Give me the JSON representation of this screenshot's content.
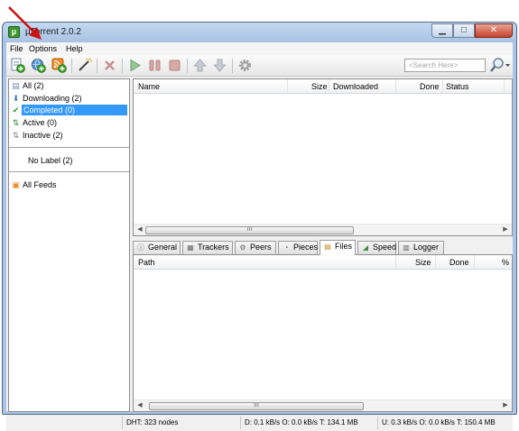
{
  "window": {
    "title": "µTorrent 2.0.2",
    "app_icon": "µ"
  },
  "menu": [
    "File",
    "Options",
    "Help"
  ],
  "toolbar": {
    "buttons": [
      {
        "name": "add-torrent",
        "icon": "add-torrent-icon"
      },
      {
        "name": "add-torrent-url",
        "icon": "add-url-icon"
      },
      {
        "name": "add-rss-feed",
        "icon": "add-rss-icon"
      },
      {
        "name": "create-torrent",
        "icon": "magic-wand-icon"
      },
      {
        "name": "remove",
        "icon": "delete-icon"
      },
      {
        "name": "start",
        "icon": "play-icon"
      },
      {
        "name": "pause",
        "icon": "pause-icon"
      },
      {
        "name": "stop",
        "icon": "stop-icon"
      },
      {
        "name": "move-up",
        "icon": "up-arrow-icon"
      },
      {
        "name": "move-down",
        "icon": "down-arrow-icon"
      },
      {
        "name": "preferences",
        "icon": "gear-icon"
      }
    ],
    "search_placeholder": "<Search Here>"
  },
  "sidebar": {
    "items": [
      {
        "label": "All (2)",
        "icon": "all-torrents-icon"
      },
      {
        "label": "Downloading (2)",
        "icon": "download-arrow-icon"
      },
      {
        "label": "Completed (0)",
        "icon": "checkmark-icon",
        "selected": true
      },
      {
        "label": "Active (0)",
        "icon": "active-arrows-icon"
      },
      {
        "label": "Inactive (2)",
        "icon": "inactive-arrows-icon"
      }
    ],
    "label_item": "No Label (2)",
    "feeds_item": "All Feeds"
  },
  "torrent_list": {
    "columns": [
      "Name",
      "Size",
      "Downloaded",
      "Done",
      "Status"
    ],
    "rows": []
  },
  "detail_tabs": [
    {
      "label": "General",
      "icon": "info-icon"
    },
    {
      "label": "Trackers",
      "icon": "trackers-icon"
    },
    {
      "label": "Peers",
      "icon": "peers-icon"
    },
    {
      "label": "Pieces",
      "icon": "pieces-icon"
    },
    {
      "label": "Files",
      "icon": "files-icon",
      "active": true
    },
    {
      "label": "Speed",
      "icon": "speed-graph-icon"
    },
    {
      "label": "Logger",
      "icon": "logger-icon"
    }
  ],
  "files_list": {
    "columns": [
      "Path",
      "Size",
      "Done",
      "%"
    ],
    "rows": []
  },
  "statusbar": {
    "dht": "DHT: 323 nodes",
    "download": "D: 0.1 kB/s O: 0.0 kB/s T: 134.1 MB",
    "upload": "U: 0.3 kB/s O: 0.0 kB/s T: 150.4 MB"
  },
  "colors": {
    "selection": "#3399ff",
    "annotation_arrow": "#cc1111",
    "window_frame": "#a9c4e4"
  }
}
